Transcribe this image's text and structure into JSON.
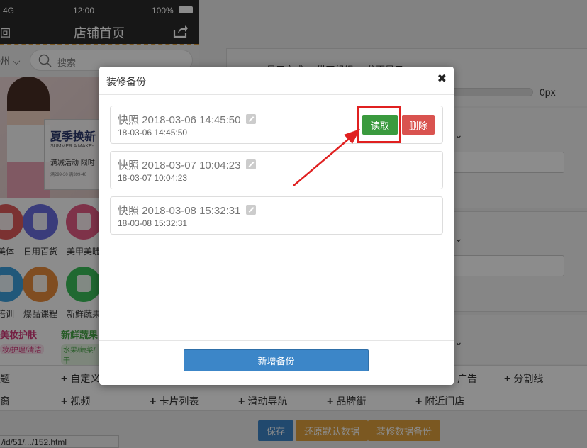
{
  "phone": {
    "status": {
      "network": "4G",
      "time": "12:00",
      "battery": "100%"
    },
    "nav": {
      "back": "回",
      "title": "店铺首页"
    },
    "search": {
      "city": "州",
      "placeholder": "搜索"
    },
    "banner": {
      "headline": "夏季换新",
      "sub": "SUMMER A MAKE-",
      "promo": "满减活动  限时",
      "fine": "满299-30  满399-40"
    },
    "categories": [
      {
        "label": "美体",
        "color": "#e05b5b"
      },
      {
        "label": "日用百货",
        "color": "#6a6de0"
      },
      {
        "label": "美甲美睫",
        "color": "#e55c86"
      },
      {
        "label": "培训",
        "color": "#3da1df"
      },
      {
        "label": "爆品课程",
        "color": "#e98c3c"
      },
      {
        "label": "新鲜蔬果",
        "color": "#3bbf5a"
      }
    ],
    "promos": [
      {
        "title": "美妆护肤",
        "sub": "妆/护理/清洁",
        "color": "#d43a7a"
      },
      {
        "title": "新鲜蔬果",
        "sub": "水果/蔬菜/干",
        "color": "#4aa84a"
      }
    ]
  },
  "right_panel": {
    "display_label": "显示方式  ◎ 纵双组织  ◎ 分页显示",
    "px_value": "0px"
  },
  "components": {
    "row1": [
      {
        "label": "题",
        "plus": false
      },
      {
        "label": "自定义",
        "plus": true
      },
      {
        "label": "广告",
        "plus": false
      },
      {
        "label": "分割线",
        "plus": true
      }
    ],
    "row2": [
      {
        "label": "窗",
        "plus": false
      },
      {
        "label": "视频",
        "plus": true
      },
      {
        "label": "卡片列表",
        "plus": true
      },
      {
        "label": "滑动导航",
        "plus": true
      },
      {
        "label": "品牌街",
        "plus": true
      },
      {
        "label": "附近门店",
        "plus": true
      }
    ]
  },
  "actions": {
    "save": "保存",
    "restore": "还原默认数据",
    "backup": "装修数据备份"
  },
  "url_tip": "/id/51/.../152.html",
  "modal": {
    "title": "装修备份",
    "close": "✖",
    "items": [
      {
        "name": "快照 2018-03-06 14:45:50",
        "time": "18-03-06 14:45:50"
      },
      {
        "name": "快照 2018-03-07 10:04:23",
        "time": "18-03-07 10:04:23"
      },
      {
        "name": "快照 2018-03-08 15:32:31",
        "time": "18-03-08 15:32:31"
      }
    ],
    "read_label": "读取",
    "delete_label": "删除",
    "new_backup_label": "新增备份"
  },
  "colors": {
    "accent_green": "#3a9a3e",
    "danger": "#d9534f",
    "primary": "#3c86c8",
    "warning": "#e0a13c",
    "annotation_red": "#e02020"
  },
  "icons": [
    "search-icon",
    "share-icon",
    "edit-icon",
    "close-icon",
    "chevron-down-icon",
    "plus-icon"
  ]
}
